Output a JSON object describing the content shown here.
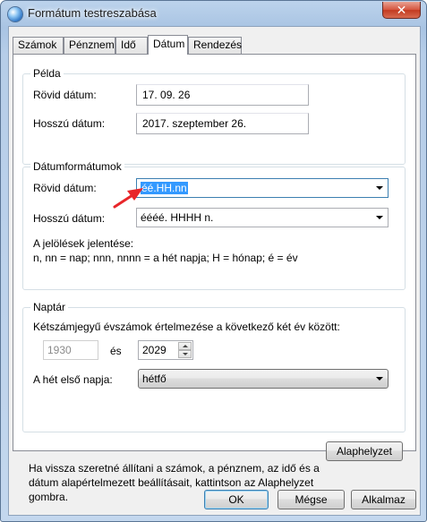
{
  "window": {
    "title": "Formátum testreszabása",
    "close_glyph": "✕"
  },
  "tabs": [
    {
      "label": "Számok",
      "active": false
    },
    {
      "label": "Pénznem",
      "active": false
    },
    {
      "label": "Idő",
      "active": false
    },
    {
      "label": "Dátum",
      "active": true
    },
    {
      "label": "Rendezés",
      "active": false
    }
  ],
  "example": {
    "title": "Példa",
    "short_label": "Rövid dátum:",
    "short_value": "17. 09. 26",
    "long_label": "Hosszú dátum:",
    "long_value": "2017. szeptember 26."
  },
  "formats": {
    "title": "Dátumformátumok",
    "short_label": "Rövid dátum:",
    "short_value": "éé.HH.nn",
    "long_label": "Hosszú dátum:",
    "long_value": "éééé. HHHH n.",
    "legend_title": "A jelölések jelentése:",
    "legend_text": "n, nn = nap; nnn, nnnn = a hét napja; H = hónap; é = év"
  },
  "calendar": {
    "title": "Naptár",
    "two_digit_label": "Kétszámjegyű évszámok értelmezése a következő két év között:",
    "year_from": "1930",
    "and_label": "és",
    "year_to": "2029",
    "first_day_label": "A hét első napja:",
    "first_day_value": "hétfő"
  },
  "footer": {
    "info_text": "Ha vissza szeretné állítani a számok, a pénznem, az idő és a dátum alapértelmezett beállításait, kattintson az Alaphelyzet gombra.",
    "reset_label": "Alaphelyzet",
    "ok_label": "OK",
    "cancel_label": "Mégse",
    "apply_label": "Alkalmaz"
  },
  "colors": {
    "selection": "#3399ff",
    "annotation_arrow": "#e8262a"
  }
}
